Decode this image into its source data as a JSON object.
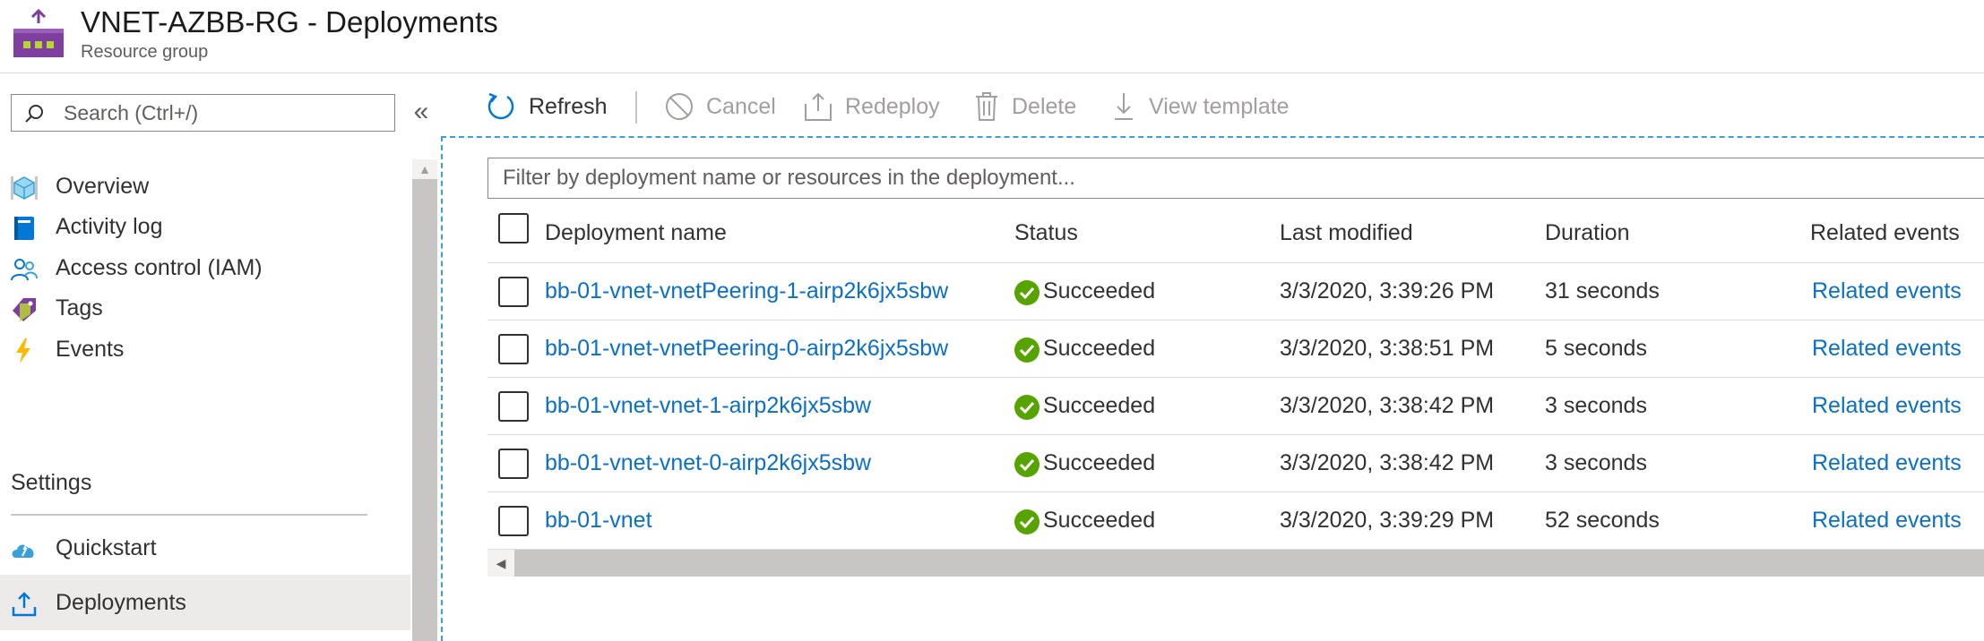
{
  "header": {
    "title": "VNET-AZBB-RG - Deployments",
    "subtitle": "Resource group",
    "icon": "resource-group-icon"
  },
  "sidebar": {
    "search_placeholder": "Search (Ctrl+/)",
    "collapse_glyph": "«",
    "items": [
      {
        "label": "Overview",
        "icon": "overview-cube-icon"
      },
      {
        "label": "Activity log",
        "icon": "activity-log-icon"
      },
      {
        "label": "Access control (IAM)",
        "icon": "iam-people-icon"
      },
      {
        "label": "Tags",
        "icon": "tag-icon"
      },
      {
        "label": "Events",
        "icon": "lightning-icon"
      }
    ],
    "section_settings": "Settings",
    "settings_items": [
      {
        "label": "Quickstart",
        "icon": "cloud-quickstart-icon"
      },
      {
        "label": "Deployments",
        "icon": "deployments-upload-icon",
        "active": true
      }
    ]
  },
  "toolbar": {
    "refresh": "Refresh",
    "cancel": "Cancel",
    "redeploy": "Redeploy",
    "delete": "Delete",
    "view_template": "View template"
  },
  "filter": {
    "placeholder": "Filter by deployment name or resources in the deployment..."
  },
  "table": {
    "columns": [
      "Deployment name",
      "Status",
      "Last modified",
      "Duration",
      "Related events"
    ],
    "rows": [
      {
        "name": "bb-01-vnet-vnetPeering-1-airp2k6jx5sbw",
        "status": "Succeeded",
        "modified": "3/3/2020, 3:39:26 PM",
        "duration": "31 seconds",
        "events": "Related events"
      },
      {
        "name": "bb-01-vnet-vnetPeering-0-airp2k6jx5sbw",
        "status": "Succeeded",
        "modified": "3/3/2020, 3:38:51 PM",
        "duration": "5 seconds",
        "events": "Related events"
      },
      {
        "name": "bb-01-vnet-vnet-1-airp2k6jx5sbw",
        "status": "Succeeded",
        "modified": "3/3/2020, 3:38:42 PM",
        "duration": "3 seconds",
        "events": "Related events"
      },
      {
        "name": "bb-01-vnet-vnet-0-airp2k6jx5sbw",
        "status": "Succeeded",
        "modified": "3/3/2020, 3:38:42 PM",
        "duration": "3 seconds",
        "events": "Related events"
      },
      {
        "name": "bb-01-vnet",
        "status": "Succeeded",
        "modified": "3/3/2020, 3:39:29 PM",
        "duration": "52 seconds",
        "events": "Related events"
      }
    ]
  },
  "colors": {
    "link": "#0a6fc7",
    "success": "#57a300",
    "accent_purple": "#7e3f9f",
    "focus_dashed": "#3aa0da"
  }
}
